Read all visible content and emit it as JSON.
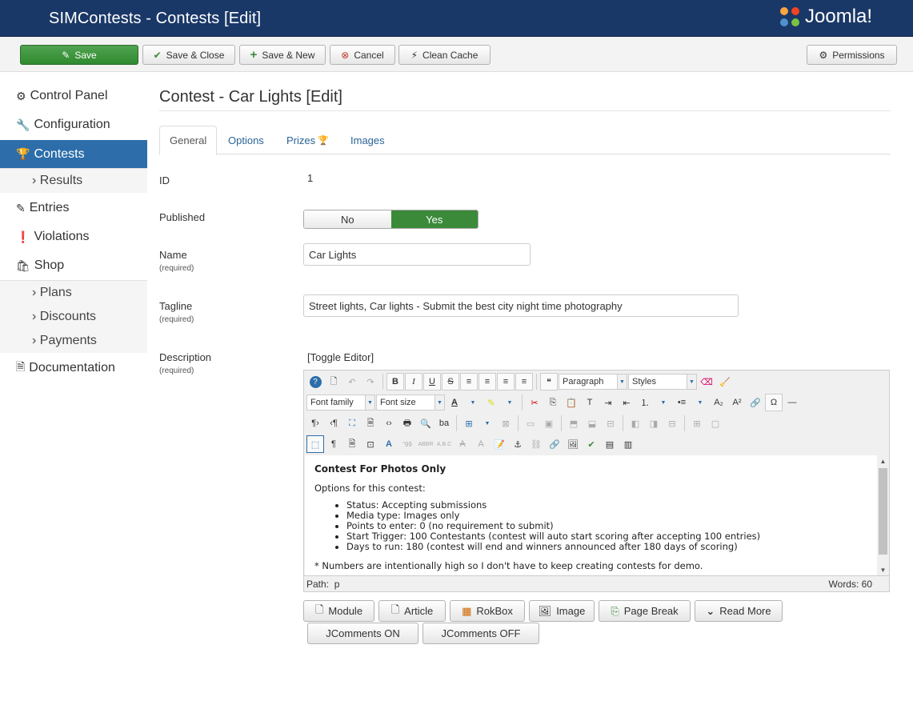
{
  "header": {
    "title": "SIMContests - Contests [Edit]",
    "logo_text": "Joomla!"
  },
  "toolbar": {
    "save": "Save",
    "save_close": "Save & Close",
    "save_new": "Save & New",
    "cancel": "Cancel",
    "clean_cache": "Clean Cache",
    "permissions": "Permissions"
  },
  "sidebar": {
    "control_panel": "Control Panel",
    "configuration": "Configuration",
    "contests": "Contests",
    "results": "Results",
    "entries": "Entries",
    "violations": "Violations",
    "shop": "Shop",
    "plans": "Plans",
    "discounts": "Discounts",
    "payments": "Payments",
    "documentation": "Documentation"
  },
  "main": {
    "title": "Contest - Car Lights [Edit]",
    "tabs": [
      "General",
      "Options",
      "Prizes",
      "Images"
    ]
  },
  "form": {
    "id_label": "ID",
    "id_value": "1",
    "published_label": "Published",
    "published_no": "No",
    "published_yes": "Yes",
    "published_value": "Yes",
    "name_label": "Name",
    "name_value": "Car Lights",
    "tagline_label": "Tagline",
    "tagline_value": "Street lights, Car lights - Submit the best city night time photography",
    "description_label": "Description",
    "required": "(required)",
    "toggle_editor": "[Toggle Editor]"
  },
  "editor": {
    "format_select": "Paragraph",
    "styles_select": "Styles",
    "font_family": "Font family",
    "font_size": "Font size",
    "heading": "Contest For Photos Only",
    "intro": "Options for this contest:",
    "bullets": [
      "Status: Accepting submissions",
      "Media type: Images only",
      "Points to enter: 0 (no requirement to submit)",
      "Start Trigger: 100 Contestants (contest will auto start scoring after accepting 100 entries)",
      "Days to run: 180 (contest will end and winners announced after 180 days of scoring)"
    ],
    "note": "* Numbers are intentionally high so I don't have to keep creating contests for demo.",
    "path_label": "Path:",
    "path_value": "p",
    "word_count": "Words: 60"
  },
  "editor_buttons": {
    "module": "Module",
    "article": "Article",
    "rokbox": "RokBox",
    "image": "Image",
    "page_break": "Page Break",
    "read_more": "Read More",
    "jcomments_on": "JComments ON",
    "jcomments_off": "JComments OFF"
  },
  "colors": {
    "header_bg": "#1a3867",
    "active_nav": "#2c6daa",
    "success": "#3a8a3a"
  }
}
